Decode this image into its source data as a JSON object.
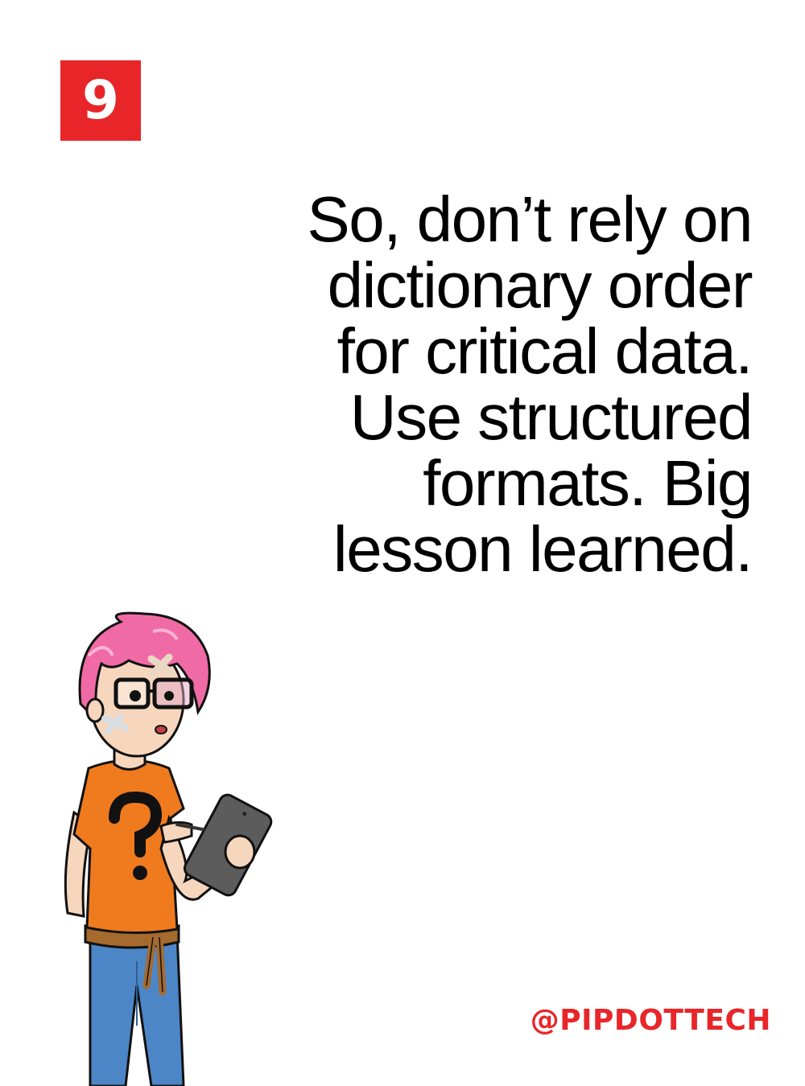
{
  "badge": {
    "number": "9",
    "color": "#e8262a"
  },
  "text_lines": [
    "So, don’t rely on",
    "dictionary order",
    "for critical data.",
    "Use structured",
    "formats. Big",
    "lesson learned."
  ],
  "handle": "@PIPDOTTECH",
  "illustration": {
    "subject": "pink-haired character in orange question-mark shirt holding a tablet",
    "colors": {
      "hair": "#f06ba6",
      "shirt": "#f07a1e",
      "jeans": "#4d86c6",
      "tablet": "#5c5c5c",
      "skin": "#f6d6bd"
    }
  }
}
